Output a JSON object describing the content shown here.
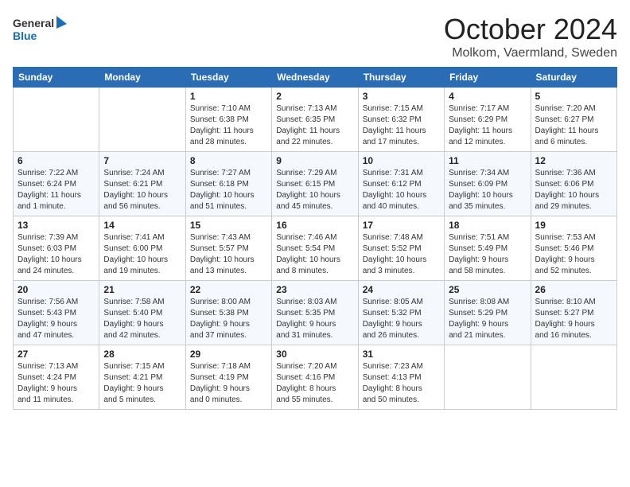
{
  "header": {
    "logo_general": "General",
    "logo_blue": "Blue",
    "month": "October 2024",
    "location": "Molkom, Vaermland, Sweden"
  },
  "days_of_week": [
    "Sunday",
    "Monday",
    "Tuesday",
    "Wednesday",
    "Thursday",
    "Friday",
    "Saturday"
  ],
  "weeks": [
    [
      {
        "day": null,
        "info": null
      },
      {
        "day": null,
        "info": null
      },
      {
        "day": "1",
        "info": "Sunrise: 7:10 AM\nSunset: 6:38 PM\nDaylight: 11 hours\nand 28 minutes."
      },
      {
        "day": "2",
        "info": "Sunrise: 7:13 AM\nSunset: 6:35 PM\nDaylight: 11 hours\nand 22 minutes."
      },
      {
        "day": "3",
        "info": "Sunrise: 7:15 AM\nSunset: 6:32 PM\nDaylight: 11 hours\nand 17 minutes."
      },
      {
        "day": "4",
        "info": "Sunrise: 7:17 AM\nSunset: 6:29 PM\nDaylight: 11 hours\nand 12 minutes."
      },
      {
        "day": "5",
        "info": "Sunrise: 7:20 AM\nSunset: 6:27 PM\nDaylight: 11 hours\nand 6 minutes."
      }
    ],
    [
      {
        "day": "6",
        "info": "Sunrise: 7:22 AM\nSunset: 6:24 PM\nDaylight: 11 hours\nand 1 minute."
      },
      {
        "day": "7",
        "info": "Sunrise: 7:24 AM\nSunset: 6:21 PM\nDaylight: 10 hours\nand 56 minutes."
      },
      {
        "day": "8",
        "info": "Sunrise: 7:27 AM\nSunset: 6:18 PM\nDaylight: 10 hours\nand 51 minutes."
      },
      {
        "day": "9",
        "info": "Sunrise: 7:29 AM\nSunset: 6:15 PM\nDaylight: 10 hours\nand 45 minutes."
      },
      {
        "day": "10",
        "info": "Sunrise: 7:31 AM\nSunset: 6:12 PM\nDaylight: 10 hours\nand 40 minutes."
      },
      {
        "day": "11",
        "info": "Sunrise: 7:34 AM\nSunset: 6:09 PM\nDaylight: 10 hours\nand 35 minutes."
      },
      {
        "day": "12",
        "info": "Sunrise: 7:36 AM\nSunset: 6:06 PM\nDaylight: 10 hours\nand 29 minutes."
      }
    ],
    [
      {
        "day": "13",
        "info": "Sunrise: 7:39 AM\nSunset: 6:03 PM\nDaylight: 10 hours\nand 24 minutes."
      },
      {
        "day": "14",
        "info": "Sunrise: 7:41 AM\nSunset: 6:00 PM\nDaylight: 10 hours\nand 19 minutes."
      },
      {
        "day": "15",
        "info": "Sunrise: 7:43 AM\nSunset: 5:57 PM\nDaylight: 10 hours\nand 13 minutes."
      },
      {
        "day": "16",
        "info": "Sunrise: 7:46 AM\nSunset: 5:54 PM\nDaylight: 10 hours\nand 8 minutes."
      },
      {
        "day": "17",
        "info": "Sunrise: 7:48 AM\nSunset: 5:52 PM\nDaylight: 10 hours\nand 3 minutes."
      },
      {
        "day": "18",
        "info": "Sunrise: 7:51 AM\nSunset: 5:49 PM\nDaylight: 9 hours\nand 58 minutes."
      },
      {
        "day": "19",
        "info": "Sunrise: 7:53 AM\nSunset: 5:46 PM\nDaylight: 9 hours\nand 52 minutes."
      }
    ],
    [
      {
        "day": "20",
        "info": "Sunrise: 7:56 AM\nSunset: 5:43 PM\nDaylight: 9 hours\nand 47 minutes."
      },
      {
        "day": "21",
        "info": "Sunrise: 7:58 AM\nSunset: 5:40 PM\nDaylight: 9 hours\nand 42 minutes."
      },
      {
        "day": "22",
        "info": "Sunrise: 8:00 AM\nSunset: 5:38 PM\nDaylight: 9 hours\nand 37 minutes."
      },
      {
        "day": "23",
        "info": "Sunrise: 8:03 AM\nSunset: 5:35 PM\nDaylight: 9 hours\nand 31 minutes."
      },
      {
        "day": "24",
        "info": "Sunrise: 8:05 AM\nSunset: 5:32 PM\nDaylight: 9 hours\nand 26 minutes."
      },
      {
        "day": "25",
        "info": "Sunrise: 8:08 AM\nSunset: 5:29 PM\nDaylight: 9 hours\nand 21 minutes."
      },
      {
        "day": "26",
        "info": "Sunrise: 8:10 AM\nSunset: 5:27 PM\nDaylight: 9 hours\nand 16 minutes."
      }
    ],
    [
      {
        "day": "27",
        "info": "Sunrise: 7:13 AM\nSunset: 4:24 PM\nDaylight: 9 hours\nand 11 minutes."
      },
      {
        "day": "28",
        "info": "Sunrise: 7:15 AM\nSunset: 4:21 PM\nDaylight: 9 hours\nand 5 minutes."
      },
      {
        "day": "29",
        "info": "Sunrise: 7:18 AM\nSunset: 4:19 PM\nDaylight: 9 hours\nand 0 minutes."
      },
      {
        "day": "30",
        "info": "Sunrise: 7:20 AM\nSunset: 4:16 PM\nDaylight: 8 hours\nand 55 minutes."
      },
      {
        "day": "31",
        "info": "Sunrise: 7:23 AM\nSunset: 4:13 PM\nDaylight: 8 hours\nand 50 minutes."
      },
      {
        "day": null,
        "info": null
      },
      {
        "day": null,
        "info": null
      }
    ]
  ]
}
